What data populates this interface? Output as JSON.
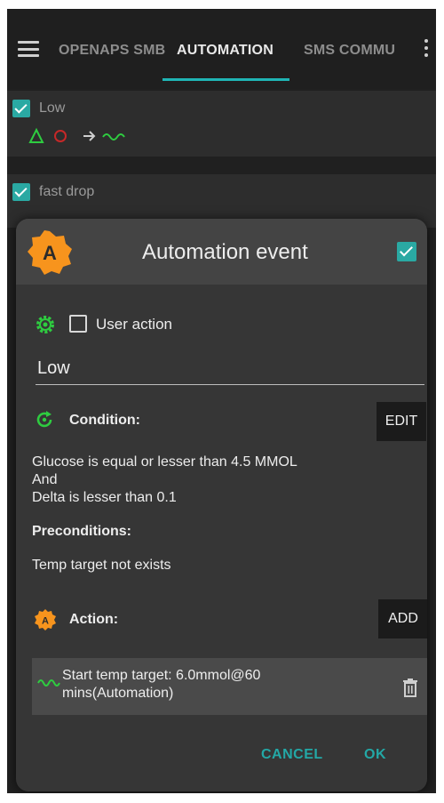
{
  "appbar": {
    "tabs": [
      {
        "label": "OPENAPS SMB"
      },
      {
        "label": "AUTOMATION"
      },
      {
        "label": "SMS COMMU"
      }
    ]
  },
  "list": {
    "items": [
      {
        "title": "Low"
      },
      {
        "title": "fast drop"
      }
    ]
  },
  "dialog": {
    "title": "Automation event",
    "enabled_checked": true,
    "user_action_label": "User action",
    "name_value": "Low",
    "condition_label": "Condition:",
    "edit_label": "EDIT",
    "condition_lines": [
      "Glucose is equal or lesser than 4.5 MMOL",
      "And",
      "Delta is lesser than 0.1"
    ],
    "preconditions_label": "Preconditions:",
    "precondition_text": "Temp target not exists",
    "action_label": "Action:",
    "add_label": "ADD",
    "action_item_text": "Start temp target: 6.0mmol@60 mins(Automation)",
    "cancel_label": "CANCEL",
    "ok_label": "OK"
  },
  "colors": {
    "accent": "#23a8a6",
    "icon_orange": "#f7941d",
    "icon_green": "#2ecc40"
  }
}
